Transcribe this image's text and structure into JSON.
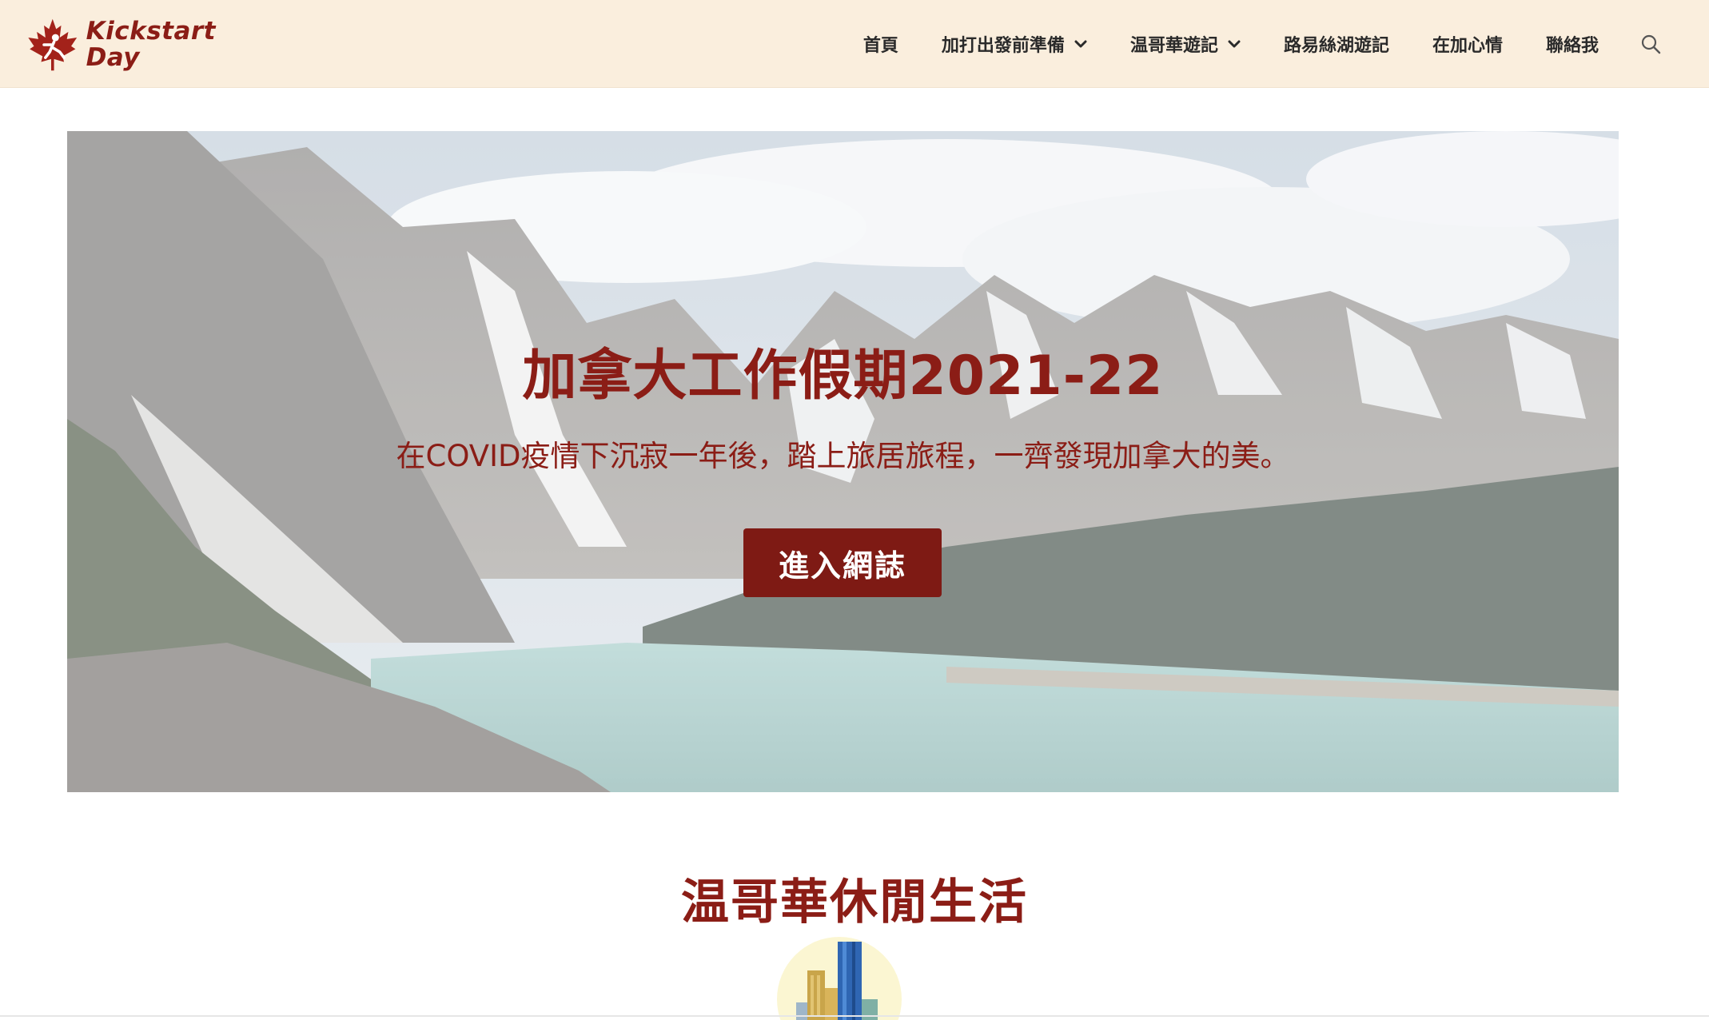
{
  "brand": {
    "name_line1": "Kickstart",
    "name_line2": "Day",
    "color": "#8b1d16"
  },
  "header": {
    "background": "#faeedd",
    "nav": [
      {
        "label": "首頁",
        "has_dropdown": false
      },
      {
        "label": "加打出發前準備",
        "has_dropdown": true
      },
      {
        "label": "温哥華遊記",
        "has_dropdown": true
      },
      {
        "label": "路易絲湖遊記",
        "has_dropdown": false
      },
      {
        "label": "在加心情",
        "has_dropdown": false
      },
      {
        "label": "聯絡我",
        "has_dropdown": false
      }
    ],
    "search_icon": "search-icon"
  },
  "hero": {
    "title": "加拿大工作假期2021-22",
    "subtitle": "在COVID疫情下沉寂一年後，踏上旅居旅程，一齊發現加拿大的美。",
    "button_label": "進入網誌",
    "button_color": "#7e1a14"
  },
  "section": {
    "title": "温哥華休閒生活"
  }
}
